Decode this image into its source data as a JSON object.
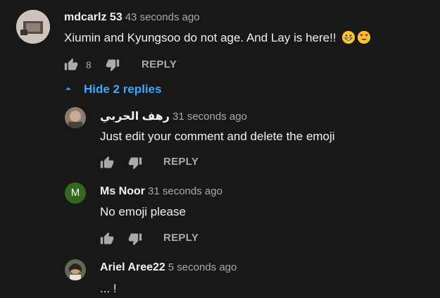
{
  "thread": {
    "author": "mdcarlz 53",
    "time": "43 seconds ago",
    "text": "Xiumin and Kyungsoo do not age. And Lay is here!! ",
    "emojis": [
      "grinning-face-emoji",
      "heart-eyes-emoji"
    ],
    "like_count": "8",
    "reply_label": "REPLY",
    "toggle_label": "Hide 2 replies",
    "colors": {
      "link": "#3ea6ff",
      "background": "#181818"
    }
  },
  "replies": [
    {
      "author": "رهف الحربي",
      "time": "31 seconds ago",
      "text": "Just edit your comment and delete the emoji",
      "reply_label": "REPLY",
      "avatar_type": "photo"
    },
    {
      "author": "Ms Noor",
      "time": "31 seconds ago",
      "text": "No emoji please",
      "reply_label": "REPLY",
      "avatar_letter": "M",
      "avatar_color": "#33691e"
    },
    {
      "author": "Ariel Aree22",
      "time": "5 seconds ago",
      "text": "... !",
      "avatar_type": "photo"
    }
  ]
}
